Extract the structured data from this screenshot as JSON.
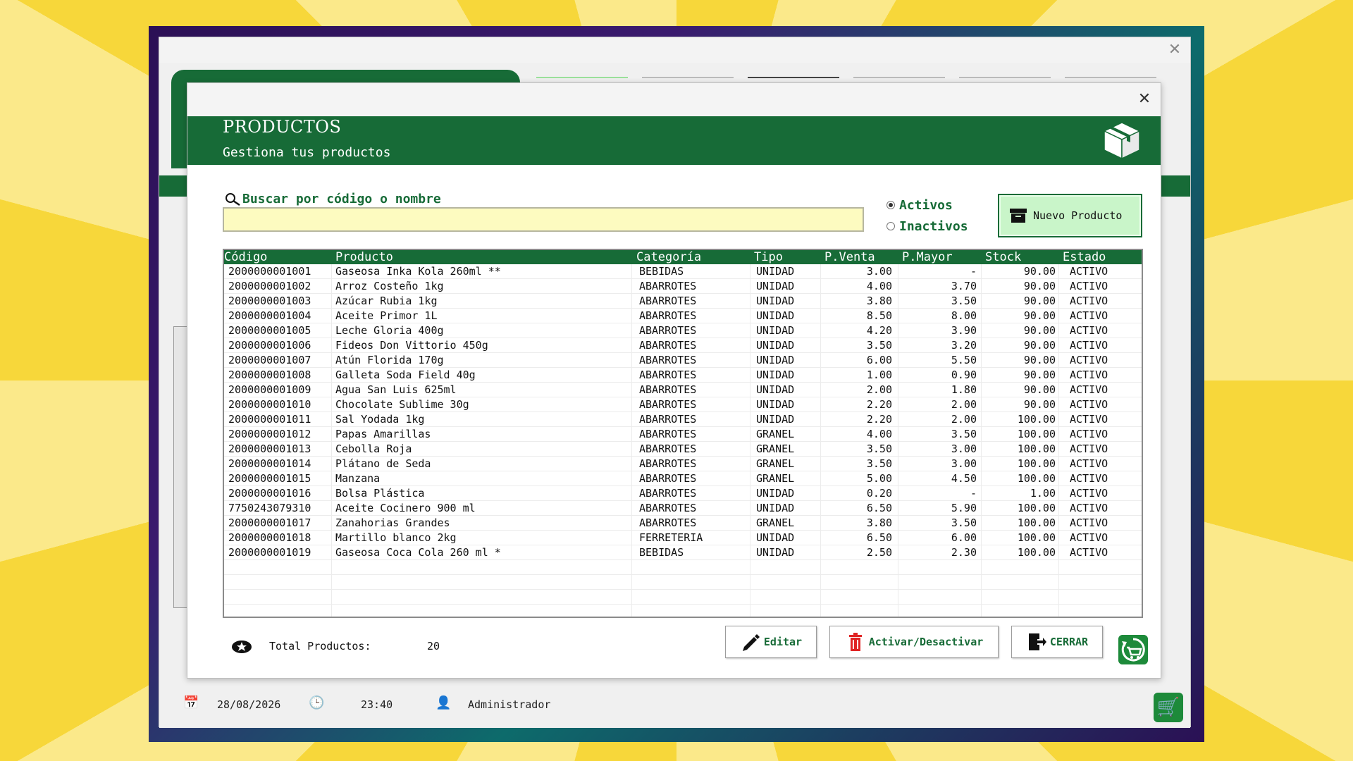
{
  "background": {
    "status": {
      "date": "28/08/2026",
      "time": "23:40",
      "user": "Administrador"
    }
  },
  "modal": {
    "title": "PRODUCTOS",
    "subtitle": "Gestiona tus productos",
    "search": {
      "label": "Buscar por código o nombre",
      "value": "",
      "placeholder": ""
    },
    "filters": {
      "active_label": "Activos",
      "inactive_label": "Inactivos",
      "selected": "Activos"
    },
    "new_button_label": "Nuevo Producto",
    "table": {
      "columns": [
        "Código",
        "Producto",
        "Categoría",
        "Tipo",
        "P.Venta",
        "P.Mayor",
        "Stock",
        "Estado"
      ],
      "rows": [
        [
          "2000000001001",
          "Gaseosa Inka Kola 260ml **",
          "BEBIDAS",
          "UNIDAD",
          "3.00",
          "-",
          "90.00",
          "ACTIVO"
        ],
        [
          "2000000001002",
          "Arroz Costeño 1kg",
          "ABARROTES",
          "UNIDAD",
          "4.00",
          "3.70",
          "90.00",
          "ACTIVO"
        ],
        [
          "2000000001003",
          "Azúcar Rubia 1kg",
          "ABARROTES",
          "UNIDAD",
          "3.80",
          "3.50",
          "90.00",
          "ACTIVO"
        ],
        [
          "2000000001004",
          "Aceite Primor 1L",
          "ABARROTES",
          "UNIDAD",
          "8.50",
          "8.00",
          "90.00",
          "ACTIVO"
        ],
        [
          "2000000001005",
          "Leche Gloria 400g",
          "ABARROTES",
          "UNIDAD",
          "4.20",
          "3.90",
          "90.00",
          "ACTIVO"
        ],
        [
          "2000000001006",
          "Fideos Don Vittorio 450g",
          "ABARROTES",
          "UNIDAD",
          "3.50",
          "3.20",
          "90.00",
          "ACTIVO"
        ],
        [
          "2000000001007",
          "Atún Florida 170g",
          "ABARROTES",
          "UNIDAD",
          "6.00",
          "5.50",
          "90.00",
          "ACTIVO"
        ],
        [
          "2000000001008",
          "Galleta Soda Field 40g",
          "ABARROTES",
          "UNIDAD",
          "1.00",
          "0.90",
          "90.00",
          "ACTIVO"
        ],
        [
          "2000000001009",
          "Agua San Luis 625ml",
          "ABARROTES",
          "UNIDAD",
          "2.00",
          "1.80",
          "90.00",
          "ACTIVO"
        ],
        [
          "2000000001010",
          "Chocolate Sublime 30g",
          "ABARROTES",
          "UNIDAD",
          "2.20",
          "2.00",
          "90.00",
          "ACTIVO"
        ],
        [
          "2000000001011",
          "Sal Yodada 1kg",
          "ABARROTES",
          "UNIDAD",
          "2.20",
          "2.00",
          "100.00",
          "ACTIVO"
        ],
        [
          "2000000001012",
          "Papas Amarillas",
          "ABARROTES",
          "GRANEL",
          "4.00",
          "3.50",
          "100.00",
          "ACTIVO"
        ],
        [
          "2000000001013",
          "Cebolla Roja",
          "ABARROTES",
          "GRANEL",
          "3.50",
          "3.00",
          "100.00",
          "ACTIVO"
        ],
        [
          "2000000001014",
          "Plátano de Seda",
          "ABARROTES",
          "GRANEL",
          "3.50",
          "3.00",
          "100.00",
          "ACTIVO"
        ],
        [
          "2000000001015",
          "Manzana",
          "ABARROTES",
          "GRANEL",
          "5.00",
          "4.50",
          "100.00",
          "ACTIVO"
        ],
        [
          "2000000001016",
          "Bolsa Plástica",
          "ABARROTES",
          "UNIDAD",
          "0.20",
          "-",
          "1.00",
          "ACTIVO"
        ],
        [
          "7750243079310",
          "Aceite Cocinero 900 ml",
          "ABARROTES",
          "UNIDAD",
          "6.50",
          "5.90",
          "100.00",
          "ACTIVO"
        ],
        [
          "2000000001017",
          "Zanahorias Grandes",
          "ABARROTES",
          "GRANEL",
          "3.80",
          "3.50",
          "100.00",
          "ACTIVO"
        ],
        [
          "2000000001018",
          "Martillo blanco 2kg",
          "FERRETERIA",
          "UNIDAD",
          "6.50",
          "6.00",
          "100.00",
          "ACTIVO"
        ],
        [
          "2000000001019",
          "Gaseosa Coca Cola 260 ml *",
          "BEBIDAS",
          "UNIDAD",
          "2.50",
          "2.30",
          "100.00",
          "ACTIVO"
        ]
      ]
    },
    "footer": {
      "total_label": "Total Productos:",
      "total_value": "20",
      "edit_label": "Editar",
      "toggle_label": "Activar/Desactivar",
      "close_label": "CERRAR"
    }
  },
  "colors": {
    "primary_green": "#176b37",
    "search_bg": "#fdfbc0",
    "new_button_bg": "#c9f5c9",
    "delete_red": "#e02424"
  }
}
